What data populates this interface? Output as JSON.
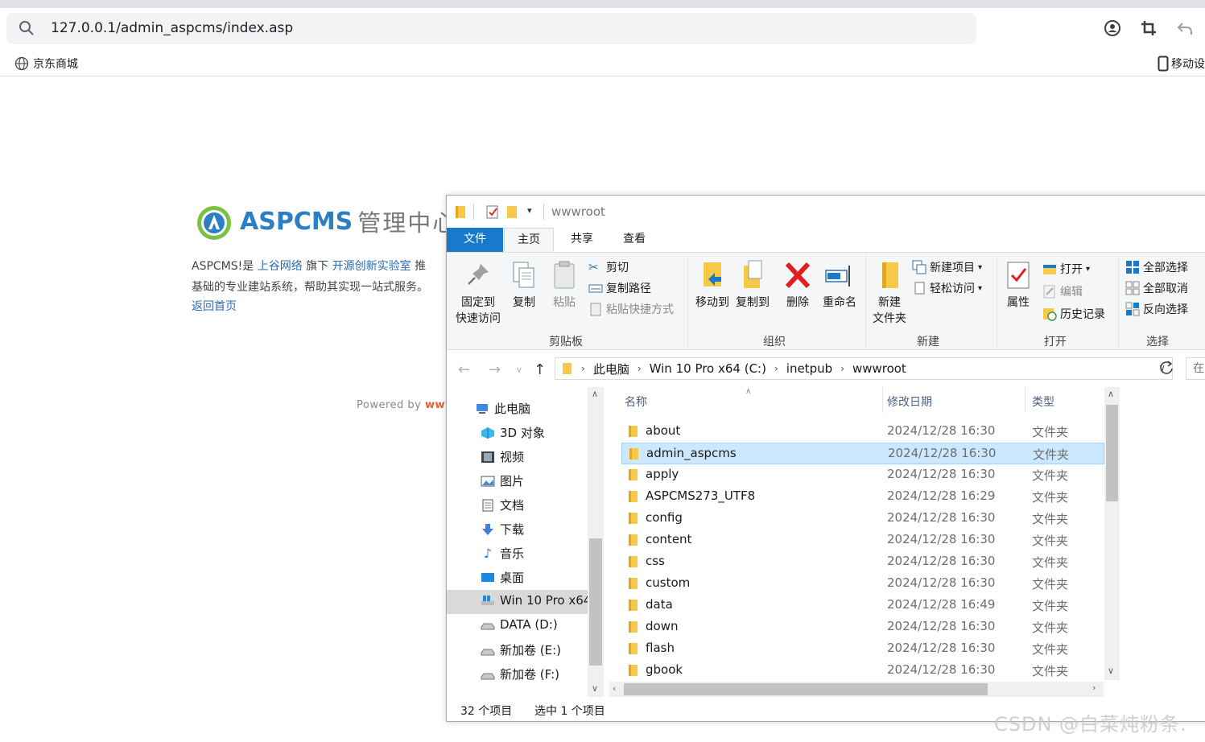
{
  "browser": {
    "url": "127.0.0.1/admin_aspcms/index.asp",
    "bookmark_label": "京东商城",
    "mobile_label": "移动设"
  },
  "page": {
    "logo_text": "ASPCMS",
    "logo_sub": "管理中心",
    "intro_prefix": "ASPCMS!是",
    "intro_link1": "上谷网络",
    "intro_mid": "旗下",
    "intro_link2": "开源创新实验室",
    "intro_suffix": "推",
    "intro_line2": "基础的专业建站系统，帮助其实现一站式服务。",
    "return_link": "返回首页",
    "powered_prefix": "Powered by",
    "powered_www": "www"
  },
  "explorer": {
    "title": "wwwroot",
    "tabs": {
      "file": "文件",
      "home": "主页",
      "share": "共享",
      "view": "查看"
    },
    "clipboard": {
      "pin_line1": "固定到",
      "pin_line2": "快速访问",
      "copy": "复制",
      "paste": "粘贴",
      "cut": "剪切",
      "copy_path": "复制路径",
      "paste_shortcut": "粘贴快捷方式",
      "label": "剪贴板"
    },
    "organize": {
      "move_to": "移动到",
      "copy_to": "复制到",
      "delete": "删除",
      "rename": "重命名",
      "label": "组织"
    },
    "new": {
      "new_folder_line1": "新建",
      "new_folder_line2": "文件夹",
      "new_item": "新建项目",
      "easy_access": "轻松访问",
      "label": "新建"
    },
    "open": {
      "properties": "属性",
      "open": "打开",
      "edit": "编辑",
      "history": "历史记录",
      "label": "打开"
    },
    "select": {
      "select_all": "全部选择",
      "select_none": "全部取消",
      "invert": "反向选择",
      "label": "选择"
    },
    "breadcrumb": [
      "此电脑",
      "Win 10 Pro x64 (C:)",
      "inetpub",
      "wwwroot"
    ],
    "search_placeholder": "在",
    "nav": [
      {
        "label": "此电脑",
        "icon": "computer-icon"
      },
      {
        "label": "3D 对象",
        "icon": "3d-objects-icon"
      },
      {
        "label": "视频",
        "icon": "video-icon"
      },
      {
        "label": "图片",
        "icon": "pictures-icon"
      },
      {
        "label": "文档",
        "icon": "documents-icon"
      },
      {
        "label": "下载",
        "icon": "download-icon"
      },
      {
        "label": "音乐",
        "icon": "music-icon"
      },
      {
        "label": "桌面",
        "icon": "desktop-icon"
      },
      {
        "label": "Win 10 Pro x64",
        "icon": "drive-c-icon"
      },
      {
        "label": "DATA (D:)",
        "icon": "drive-icon"
      },
      {
        "label": "新加卷 (E:)",
        "icon": "drive-icon"
      },
      {
        "label": "新加卷 (F:)",
        "icon": "drive-icon"
      }
    ],
    "columns": {
      "name": "名称",
      "date": "修改日期",
      "type": "类型"
    },
    "files": [
      {
        "name": "about",
        "date": "2024/12/28 16:30",
        "type": "文件夹"
      },
      {
        "name": "admin_aspcms",
        "date": "2024/12/28 16:30",
        "type": "文件夹",
        "selected": true
      },
      {
        "name": "apply",
        "date": "2024/12/28 16:30",
        "type": "文件夹"
      },
      {
        "name": "ASPCMS273_UTF8",
        "date": "2024/12/28 16:29",
        "type": "文件夹"
      },
      {
        "name": "config",
        "date": "2024/12/28 16:30",
        "type": "文件夹"
      },
      {
        "name": "content",
        "date": "2024/12/28 16:30",
        "type": "文件夹"
      },
      {
        "name": "css",
        "date": "2024/12/28 16:30",
        "type": "文件夹"
      },
      {
        "name": "custom",
        "date": "2024/12/28 16:30",
        "type": "文件夹"
      },
      {
        "name": "data",
        "date": "2024/12/28 16:49",
        "type": "文件夹"
      },
      {
        "name": "down",
        "date": "2024/12/28 16:30",
        "type": "文件夹"
      },
      {
        "name": "flash",
        "date": "2024/12/28 16:30",
        "type": "文件夹"
      },
      {
        "name": "gbook",
        "date": "2024/12/28 16:30",
        "type": "文件夹"
      }
    ],
    "status_count": "32 个项目",
    "status_selected": "选中 1 个项目"
  },
  "watermark": "CSDN @白菜炖粉条.",
  "colors": {
    "accent": "#1979ca",
    "selection": "#cce8ff",
    "folder": "#f7c948",
    "link": "#2b6cb0"
  }
}
